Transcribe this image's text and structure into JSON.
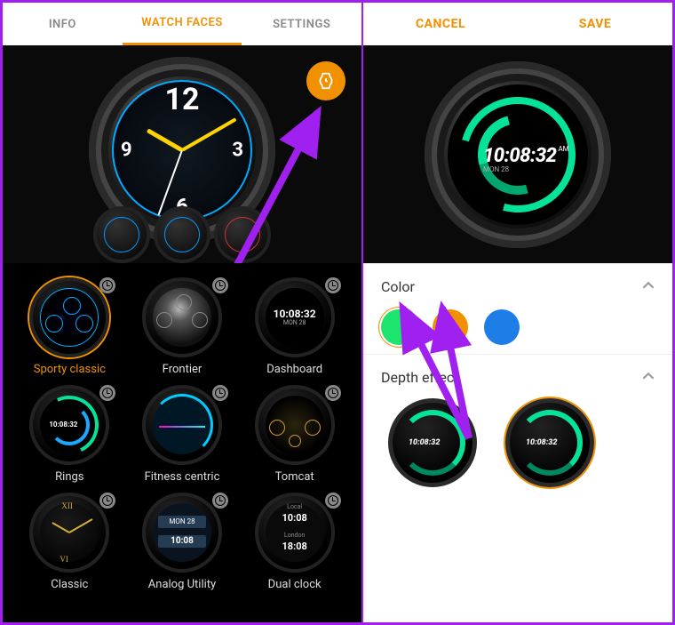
{
  "left": {
    "tabs": {
      "info": "INFO",
      "watch_faces": "WATCH FACES",
      "settings": "SETTINGS",
      "active": "watch_faces"
    },
    "faces": [
      {
        "id": "sporty",
        "label": "Sporty classic",
        "selected": true
      },
      {
        "id": "frontier",
        "label": "Frontier",
        "selected": false
      },
      {
        "id": "dash",
        "label": "Dashboard",
        "selected": false,
        "time": "10:08:32",
        "date": "MON 28"
      },
      {
        "id": "rings",
        "label": "Rings",
        "selected": false,
        "time": "10:08:32"
      },
      {
        "id": "fit",
        "label": "Fitness centric",
        "selected": false
      },
      {
        "id": "tom",
        "label": "Tomcat",
        "selected": false
      },
      {
        "id": "classic",
        "label": "Classic",
        "selected": false
      },
      {
        "id": "analog",
        "label": "Analog Utility",
        "selected": false,
        "line1": "MON 28",
        "line2": "10:08"
      },
      {
        "id": "dual",
        "label": "Dual clock",
        "selected": false,
        "city1": "Local",
        "time1": "10:08",
        "city2": "London",
        "time2": "18:08"
      }
    ]
  },
  "right": {
    "actions": {
      "cancel": "CANCEL",
      "save": "SAVE"
    },
    "preview_time": "10:08:32",
    "preview_ampm": "AM",
    "preview_date": "MON 28",
    "color_section": {
      "title": "Color",
      "swatches": [
        {
          "name": "green",
          "hex": "#1DE36F",
          "selected": true
        },
        {
          "name": "orange",
          "hex": "#F29100",
          "selected": false
        },
        {
          "name": "blue",
          "hex": "#1E7EE8",
          "selected": false
        }
      ]
    },
    "depth_section": {
      "title": "Depth effect",
      "options": [
        {
          "name": "depth-on",
          "time": "10:08:32",
          "selected": false
        },
        {
          "name": "depth-off",
          "time": "10:08:32",
          "selected": true
        }
      ]
    }
  },
  "colors": {
    "accent": "#F29100",
    "annotation": "#A020F0"
  }
}
